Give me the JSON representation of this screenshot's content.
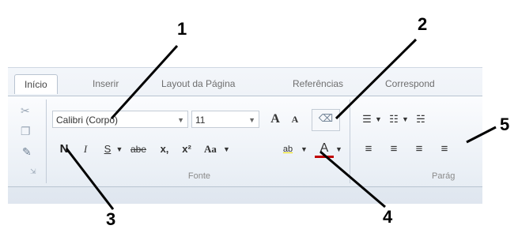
{
  "tabs": [
    "Início",
    "Inserir",
    "Layout da Página",
    "Referências",
    "Correspond"
  ],
  "font": {
    "group_label": "Fonte",
    "font_name": "Calibri (Corpo)",
    "font_size": "11",
    "grow_label": "A",
    "shrink_label": "A",
    "bold_label": "N",
    "italic_label": "I",
    "underline_label": "S",
    "strike_label": "abe",
    "subscript_label": "x,",
    "superscript_label": "x²",
    "case_label": "Aa",
    "highlight_label": "ab",
    "color_label": "A"
  },
  "paragraph": {
    "group_label": "Parág"
  },
  "callouts": [
    "1",
    "2",
    "3",
    "4",
    "5"
  ]
}
